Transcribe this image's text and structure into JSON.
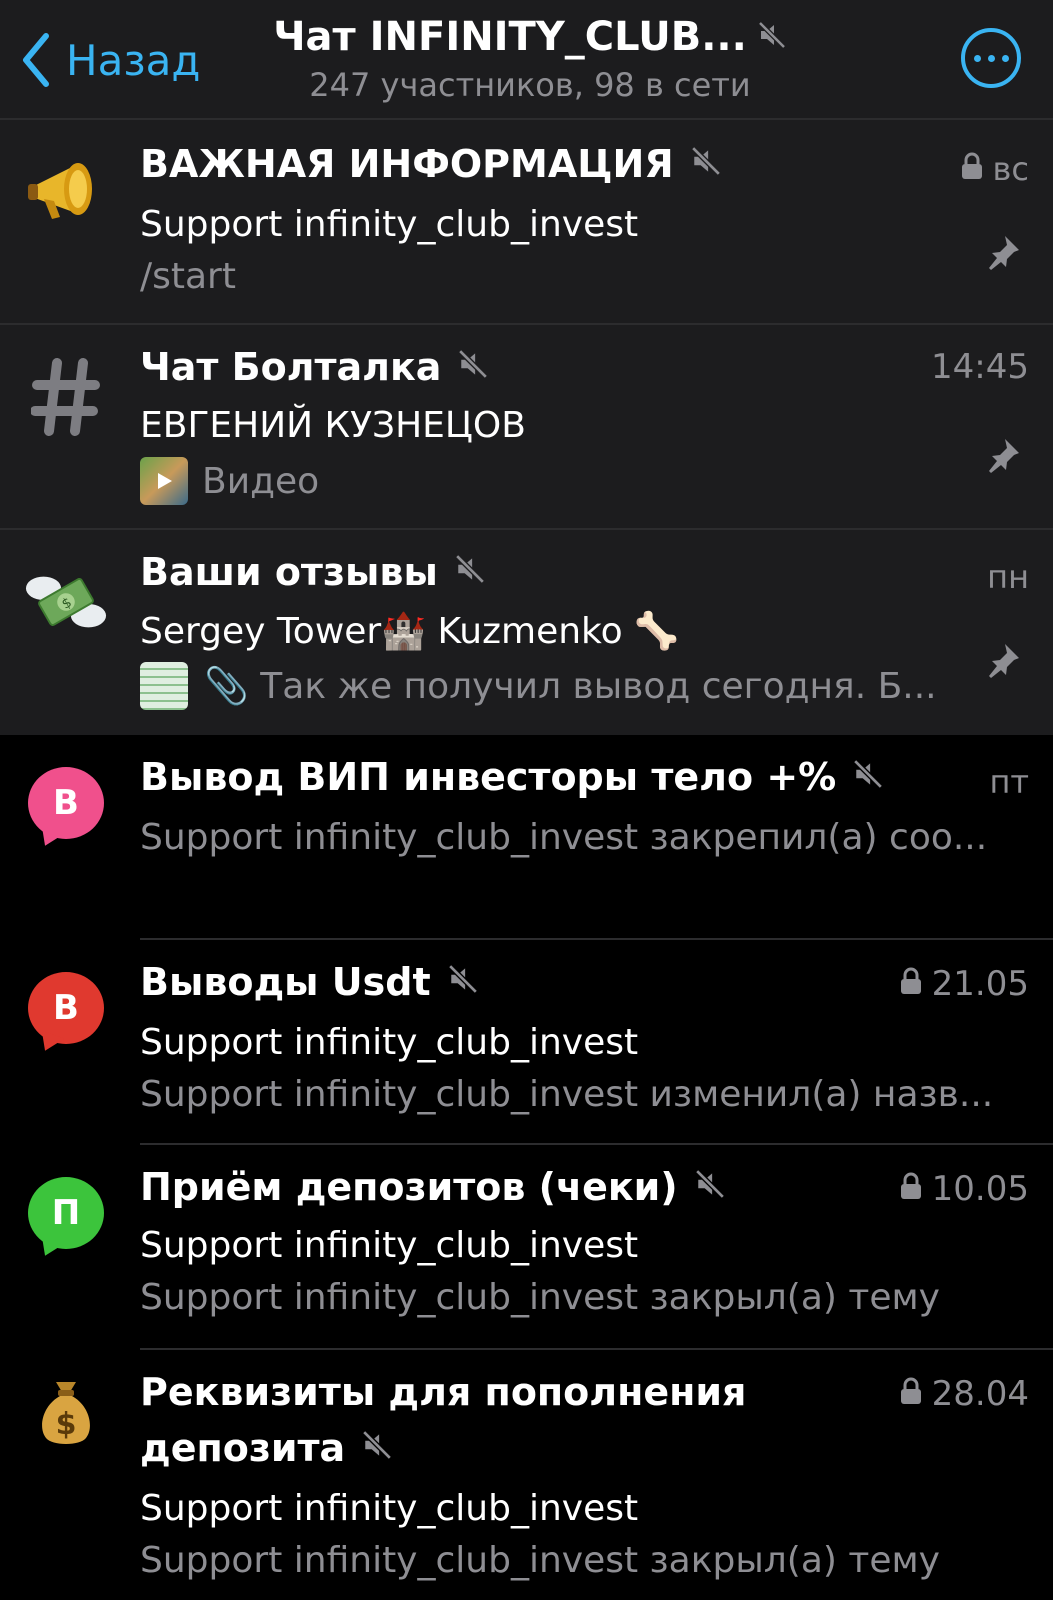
{
  "header": {
    "back_label": "Назад",
    "title": "Чат INFINITY_CLUB...",
    "subtitle": "247 участников, 98 в сети"
  },
  "topics": [
    {
      "title": "ВАЖНАЯ ИНФОРМАЦИЯ",
      "sender": "Support infinity_club_invest",
      "preview": "/start",
      "time": "вс",
      "locked": true,
      "pinned": true,
      "icon": "megaphone-icon"
    },
    {
      "title": "Чат Болталка",
      "sender": "ЕВГЕНИЙ КУЗНЕЦОВ",
      "preview": "Видео",
      "time": "14:45",
      "locked": false,
      "pinned": true,
      "icon": "hash-icon"
    },
    {
      "title": "Ваши отзывы",
      "sender": "Sergey Tower🏰 Kuzmenko 🦴",
      "preview": "📎 Так же получил вывод сегодня. Б...",
      "time": "пн",
      "locked": false,
      "pinned": true,
      "icon": "money-wings-icon"
    },
    {
      "title": "Вывод ВИП инвесторы тело +%",
      "sender": "",
      "preview": "Support infinity_club_invest закрепил(а) соо...",
      "time": "пт",
      "locked": false,
      "pinned": false,
      "icon": "topic-bubble-icon",
      "letter": "В",
      "color": "#f0508c"
    },
    {
      "title": "Выводы Usdt",
      "sender": "Support infinity_club_invest",
      "preview": "Support infinity_club_invest изменил(а) назв...",
      "time": "21.05",
      "locked": true,
      "pinned": false,
      "icon": "topic-bubble-icon",
      "letter": "В",
      "color": "#e0392f"
    },
    {
      "title": "Приём депозитов (чеки)",
      "sender": "Support infinity_club_invest",
      "preview": "Support infinity_club_invest закрыл(а) тему",
      "time": "10.05",
      "locked": true,
      "pinned": false,
      "icon": "topic-bubble-icon",
      "letter": "П",
      "color": "#3cc43c"
    },
    {
      "title": "Реквизиты для пополнения",
      "title2": "депозита",
      "sender": "Support infinity_club_invest",
      "preview": "Support infinity_club_invest закрыл(а) тему",
      "time": "28.04",
      "locked": true,
      "pinned": false,
      "icon": "money-bag-icon"
    }
  ],
  "colors": {
    "accent": "#3ab4f2",
    "pinned_bg": "#1c1c1e",
    "secondary_text": "#8e8e93"
  }
}
